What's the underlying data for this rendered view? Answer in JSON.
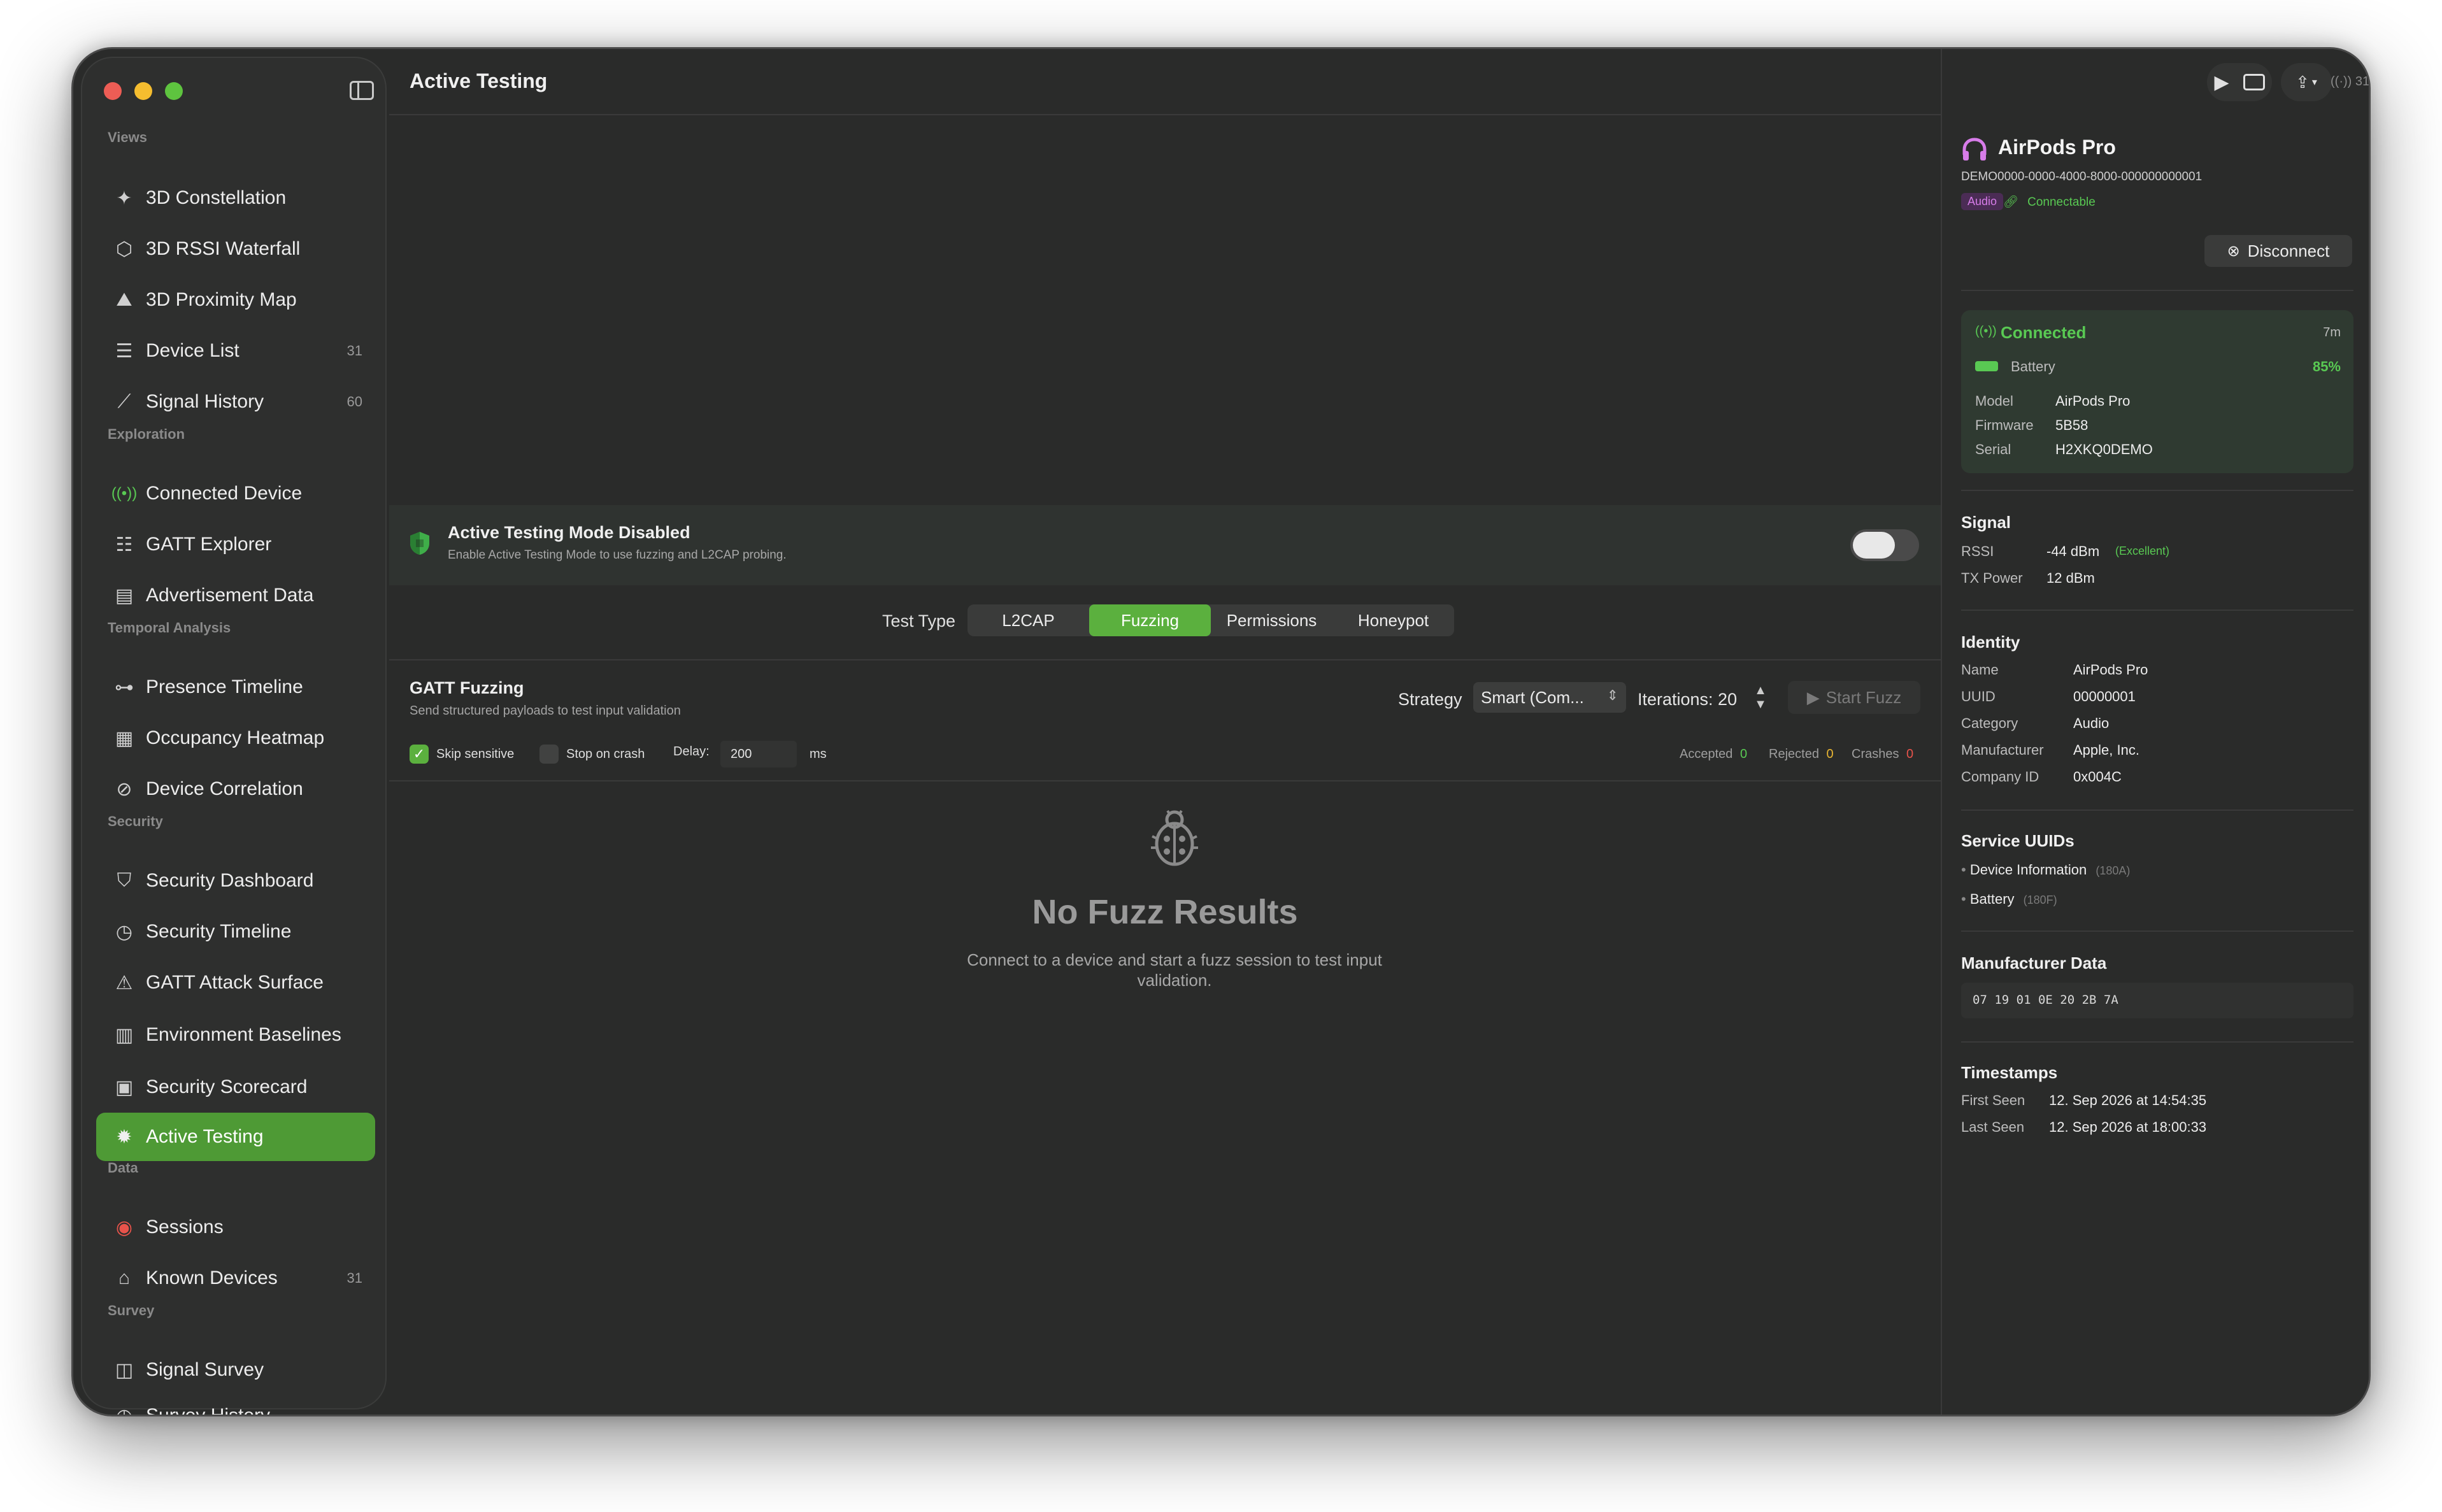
{
  "window": {
    "traffic_colors": [
      "#ed5d55",
      "#f5bd2f",
      "#5ec43f"
    ]
  },
  "sidebar": {
    "sections": [
      {
        "title": "Views",
        "items": [
          {
            "label": "3D Constellation",
            "icon": "sparkles-icon",
            "count": ""
          },
          {
            "label": "3D RSSI Waterfall",
            "icon": "cube-icon",
            "count": ""
          },
          {
            "label": "3D Proximity Map",
            "icon": "mountains-icon",
            "count": ""
          },
          {
            "label": "Device List",
            "icon": "list-icon",
            "count": "31"
          },
          {
            "label": "Signal History",
            "icon": "chart-line-icon",
            "count": "60"
          }
        ]
      },
      {
        "title": "Exploration",
        "items": [
          {
            "label": "Connected Device",
            "icon": "antenna-icon",
            "count": ""
          },
          {
            "label": "GATT Explorer",
            "icon": "list-indent-icon",
            "count": ""
          },
          {
            "label": "Advertisement Data",
            "icon": "document-icon",
            "count": ""
          }
        ]
      },
      {
        "title": "Temporal Analysis",
        "items": [
          {
            "label": "Presence Timeline",
            "icon": "timeline-icon",
            "count": ""
          },
          {
            "label": "Occupancy Heatmap",
            "icon": "grid-icon",
            "count": ""
          },
          {
            "label": "Device Correlation",
            "icon": "link-circle-icon",
            "count": ""
          }
        ]
      },
      {
        "title": "Security",
        "items": [
          {
            "label": "Security Dashboard",
            "icon": "shield-icon",
            "count": ""
          },
          {
            "label": "Security Timeline",
            "icon": "clock-shield-icon",
            "count": ""
          },
          {
            "label": "GATT Attack Surface",
            "icon": "warning-icon",
            "count": ""
          },
          {
            "label": "Environment Baselines",
            "icon": "building-icon",
            "count": ""
          },
          {
            "label": "Security Scorecard",
            "icon": "clipboard-icon",
            "count": ""
          },
          {
            "label": "Active Testing",
            "icon": "bug-icon",
            "count": "",
            "active": true
          }
        ]
      },
      {
        "title": "Data",
        "items": [
          {
            "label": "Sessions",
            "icon": "record-icon",
            "count": ""
          },
          {
            "label": "Known Devices",
            "icon": "tray-icon",
            "count": "31"
          }
        ]
      },
      {
        "title": "Survey",
        "items": [
          {
            "label": "Signal Survey",
            "icon": "map-icon",
            "count": ""
          },
          {
            "label": "Survey History",
            "icon": "history-icon",
            "count": ""
          }
        ]
      }
    ]
  },
  "main": {
    "title": "Active Testing",
    "banner": {
      "title": "Active Testing Mode Disabled",
      "subtitle": "Enable Active Testing Mode to use fuzzing and L2CAP probing."
    },
    "test_type_label": "Test Type",
    "test_types": [
      "L2CAP",
      "Fuzzing",
      "Permissions",
      "Honeypot"
    ],
    "test_type_selected": "Fuzzing",
    "fuzz": {
      "title": "GATT Fuzzing",
      "subtitle": "Send structured payloads to test input validation",
      "strategy_label": "Strategy",
      "strategy_value": "Smart (Com...",
      "iterations_label": "Iterations: 20",
      "start_label": "Start Fuzz",
      "skip_sensitive": "Skip sensitive",
      "stop_on_crash": "Stop on crash",
      "delay_label": "Delay:",
      "delay_value": "200",
      "delay_unit": "ms",
      "accepted_label": "Accepted",
      "accepted_value": "0",
      "rejected_label": "Rejected",
      "rejected_value": "0",
      "crashes_label": "Crashes",
      "crashes_value": "0"
    },
    "empty": {
      "title": "No Fuzz Results",
      "subtitle": "Connect to a device and start a fuzz session to test input validation."
    }
  },
  "inspector": {
    "toolbar_count": "31",
    "device": {
      "name": "AirPods Pro",
      "uuid": "DEMO0000-0000-4000-8000-000000000001",
      "tag": "Audio",
      "connectable": "Connectable",
      "disconnect": "Disconnect"
    },
    "connection": {
      "status": "Connected",
      "duration": "7m",
      "battery_label": "Battery",
      "battery_value": "85%",
      "model_label": "Model",
      "model_value": "AirPods Pro",
      "firmware_label": "Firmware",
      "firmware_value": "5B58",
      "serial_label": "Serial",
      "serial_value": "H2XKQ0DEMO"
    },
    "signal": {
      "title": "Signal",
      "rssi_label": "RSSI",
      "rssi_value": "-44 dBm",
      "rssi_quality": "(Excellent)",
      "tx_label": "TX Power",
      "tx_value": "12 dBm"
    },
    "identity": {
      "title": "Identity",
      "rows": [
        {
          "label": "Name",
          "value": "AirPods Pro"
        },
        {
          "label": "UUID",
          "value": "00000001"
        },
        {
          "label": "Category",
          "value": "Audio"
        },
        {
          "label": "Manufacturer",
          "value": "Apple, Inc."
        },
        {
          "label": "Company ID",
          "value": "0x004C"
        }
      ]
    },
    "services": {
      "title": "Service UUIDs",
      "items": [
        {
          "name": "Device Information",
          "uuid": "(180A)"
        },
        {
          "name": "Battery",
          "uuid": "(180F)"
        }
      ]
    },
    "manufacturer_data": {
      "title": "Manufacturer Data",
      "hex": "07 19 01 0E 20 2B 7A"
    },
    "timestamps": {
      "title": "Timestamps",
      "first_label": "First Seen",
      "first_value": "12. Sep 2026 at 14:54:35",
      "last_label": "Last Seen",
      "last_value": "12. Sep 2026 at 18:00:33"
    }
  },
  "colors": {
    "accent": "#5bb03e",
    "connected_green": "#59c953",
    "yellow_stat": "#e9b632",
    "red_stat": "#e8534b"
  }
}
